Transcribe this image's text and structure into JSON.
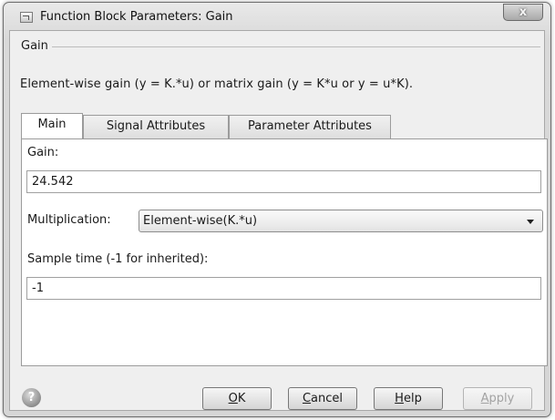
{
  "window": {
    "title": "Function Block Parameters: Gain",
    "close_glyph": "x"
  },
  "group": {
    "title": "Gain",
    "description": "Element-wise gain (y = K.*u) or matrix gain (y = K*u or y = u*K)."
  },
  "tabs": [
    {
      "label": "Main",
      "active": true
    },
    {
      "label": "Signal Attributes",
      "active": false
    },
    {
      "label": "Parameter Attributes",
      "active": false
    }
  ],
  "main": {
    "gain_label": "Gain:",
    "gain_value": "24.542",
    "multiplication_label": "Multiplication:",
    "multiplication_value": "Element-wise(K.*u)",
    "sample_time_label": "Sample time (-1 for inherited):",
    "sample_time_value": "-1"
  },
  "buttons": {
    "ok": {
      "mnemonic": "O",
      "rest": "K"
    },
    "cancel": {
      "mnemonic": "C",
      "rest": "ancel"
    },
    "help": {
      "mnemonic": "H",
      "rest": "elp"
    },
    "apply": {
      "mnemonic": "A",
      "rest": "pply",
      "enabled": false
    }
  },
  "icons": {
    "help": "question-mark-icon",
    "dropdown": "chevron-down-icon",
    "app": "simulink-block-icon"
  }
}
